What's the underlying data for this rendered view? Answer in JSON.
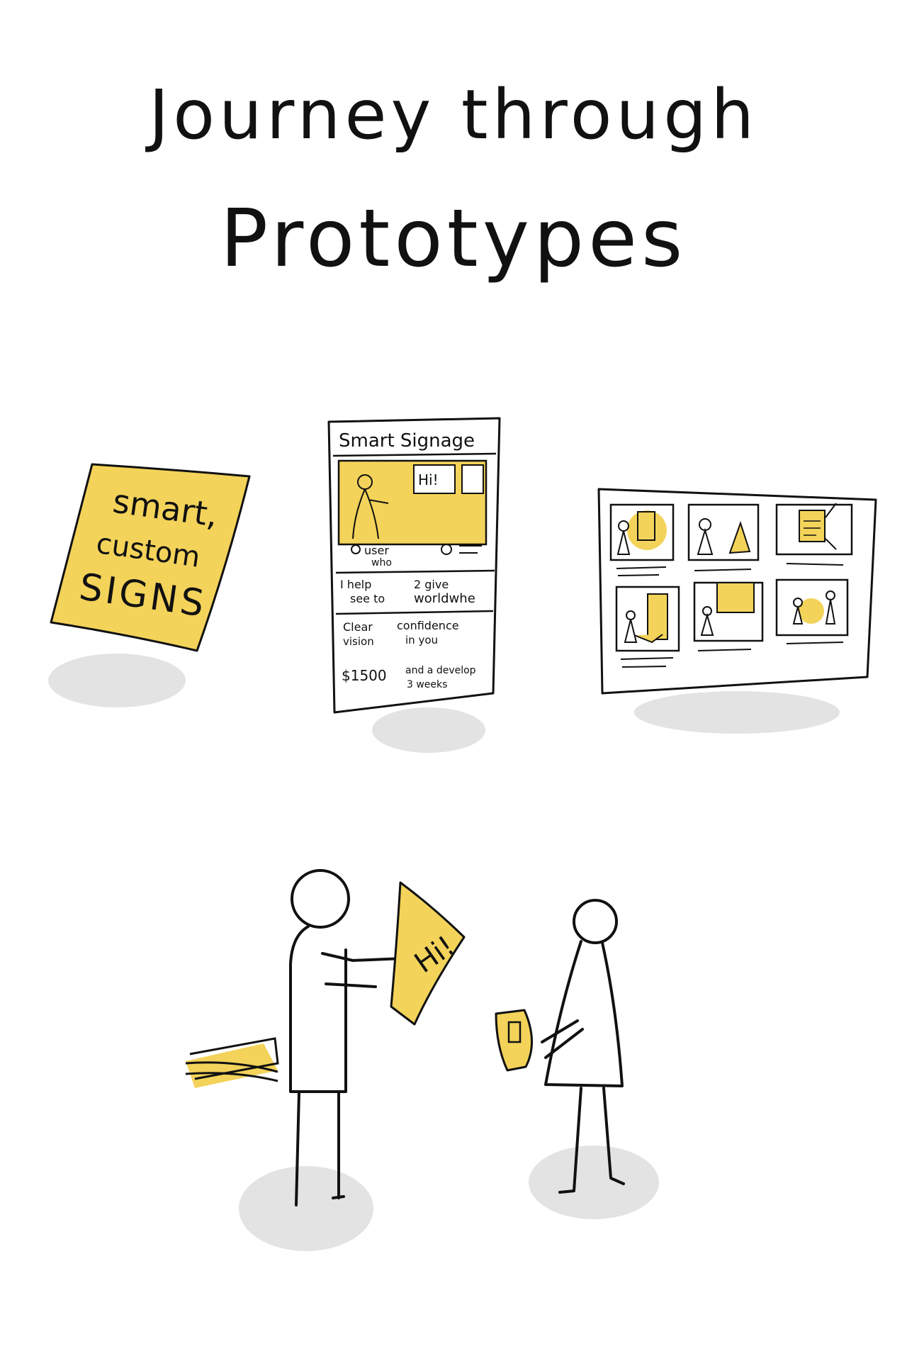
{
  "title": {
    "line1": "Journey through",
    "line2": "Prototypes"
  },
  "prototype_note": {
    "line1": "smart,",
    "line2": "custom",
    "line3": "SIGNS"
  },
  "prototype_sheet": {
    "heading": "Smart Signage",
    "hi_label": "Hi!",
    "row1_a": "user",
    "row1_b": "who",
    "row2_a": "I help",
    "row2_b": "see to",
    "row2_c": "2 give",
    "row2_d": "worldwhe",
    "row3_a": "Clear",
    "row3_b": "vision",
    "row3_c": "confidence",
    "row3_d": "in you",
    "price": "$1500",
    "timeline_a": "and a develop",
    "timeline_b": "3 weeks"
  },
  "scene": {
    "held_sign_text": "Hi!"
  },
  "colors": {
    "accent_yellow": "#f3d35a",
    "ink": "#111111",
    "shadow": "#e3e3e3"
  }
}
